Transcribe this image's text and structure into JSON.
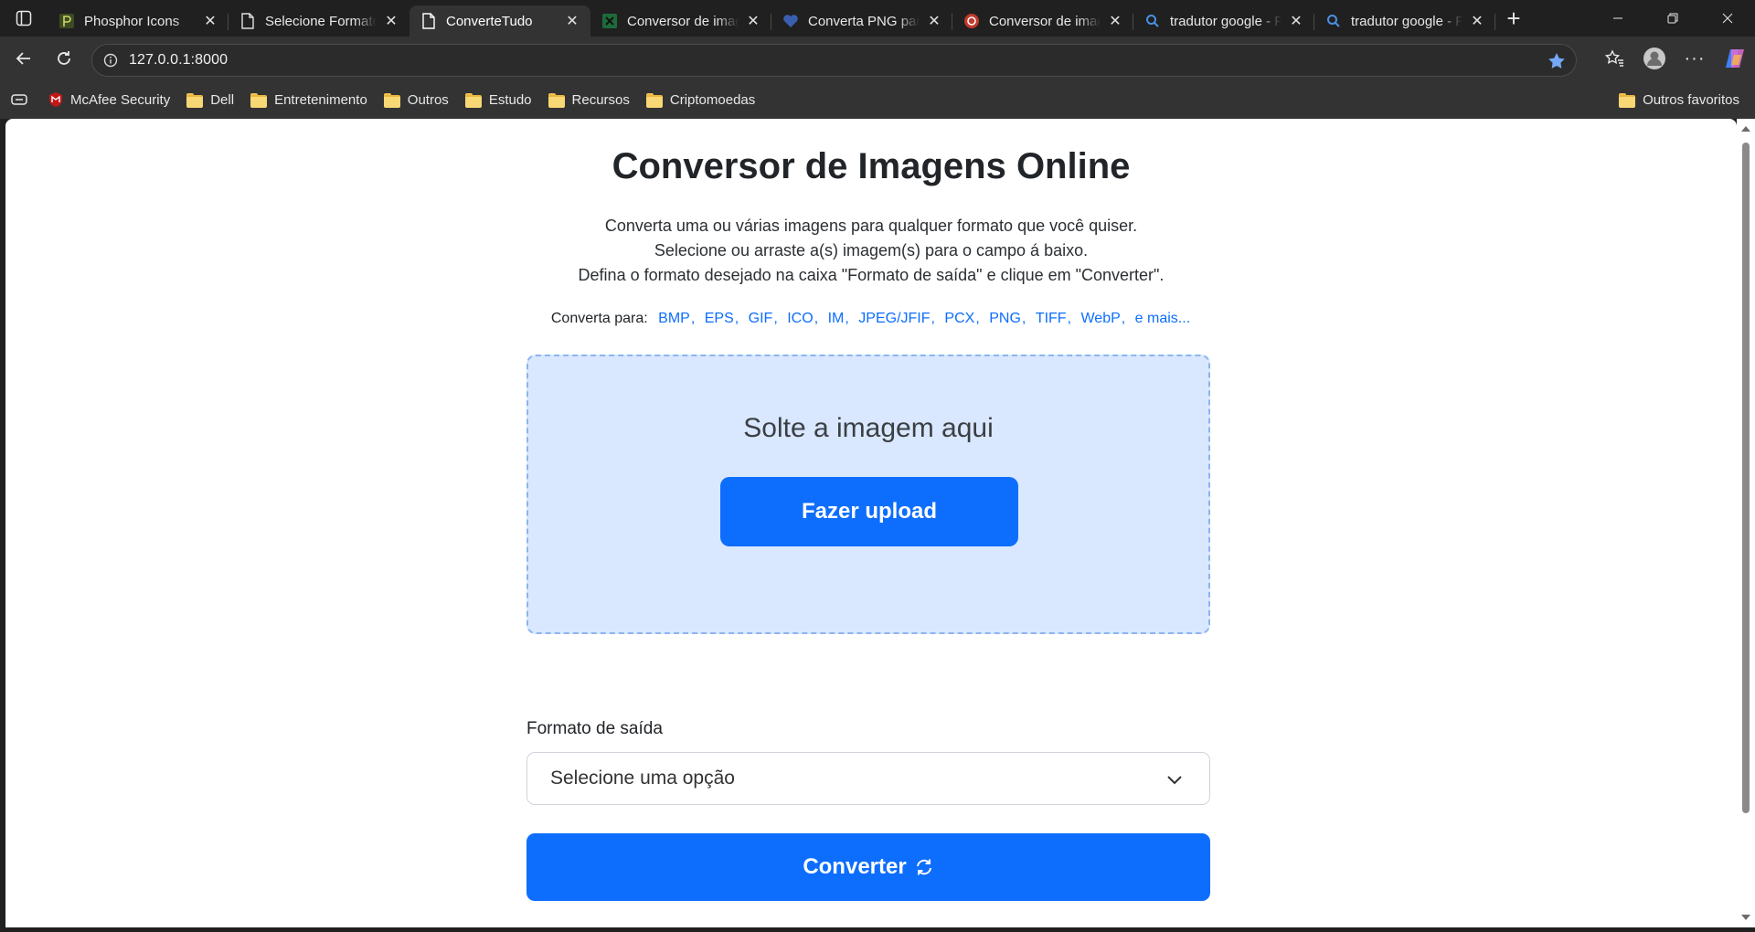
{
  "browser": {
    "tabs": [
      {
        "title": "Phosphor Icons",
        "icon": "phosphor-icon",
        "active": false
      },
      {
        "title": "Selecione Formato",
        "icon": "page-icon",
        "active": false
      },
      {
        "title": "ConverteTudo",
        "icon": "page-icon",
        "active": true
      },
      {
        "title": "Conversor de imagens",
        "icon": "spreadsheet-icon",
        "active": false
      },
      {
        "title": "Converta PNG para",
        "icon": "heart-icon",
        "active": false
      },
      {
        "title": "Conversor de imagens",
        "icon": "circle-arrows-icon",
        "active": false
      },
      {
        "title": "tradutor google - Pesquisar",
        "icon": "search-icon",
        "active": false
      },
      {
        "title": "tradutor google - Pesquisar",
        "icon": "search-icon",
        "active": false
      }
    ],
    "address": "127.0.0.1:8000",
    "bookmarks": [
      {
        "label": "McAfee Security",
        "icon": "mcafee-icon"
      },
      {
        "label": "Dell",
        "icon": "folder-icon"
      },
      {
        "label": "Entretenimento",
        "icon": "folder-icon"
      },
      {
        "label": "Outros",
        "icon": "folder-icon"
      },
      {
        "label": "Estudo",
        "icon": "folder-icon"
      },
      {
        "label": "Recursos",
        "icon": "folder-icon"
      },
      {
        "label": "Criptomoedas",
        "icon": "folder-icon"
      }
    ],
    "other_bookmarks": "Outros favoritos"
  },
  "page": {
    "title": "Conversor de Imagens Online",
    "description": [
      "Converta uma ou várias imagens para qualquer formato que você quiser.",
      "Selecione ou arraste a(s) imagem(s) para o campo á baixo.",
      "Defina o formato desejado na caixa \"Formato de saída\" e clique em \"Converter\"."
    ],
    "formats_label": "Converta para:",
    "formats": [
      "BMP",
      "EPS",
      "GIF",
      "ICO",
      "IM",
      "JPEG/JFIF",
      "PCX",
      "PNG",
      "TIFF",
      "WebP"
    ],
    "more_link": "e mais...",
    "dropzone_text": "Solte a imagem aqui",
    "upload_button": "Fazer upload",
    "output_label": "Formato de saída",
    "output_placeholder": "Selecione uma opção",
    "convert_button": "Converter"
  },
  "colors": {
    "primary": "#0d6efd",
    "dropzone_bg": "#d9e8ff",
    "dropzone_border": "#8db4ef"
  }
}
